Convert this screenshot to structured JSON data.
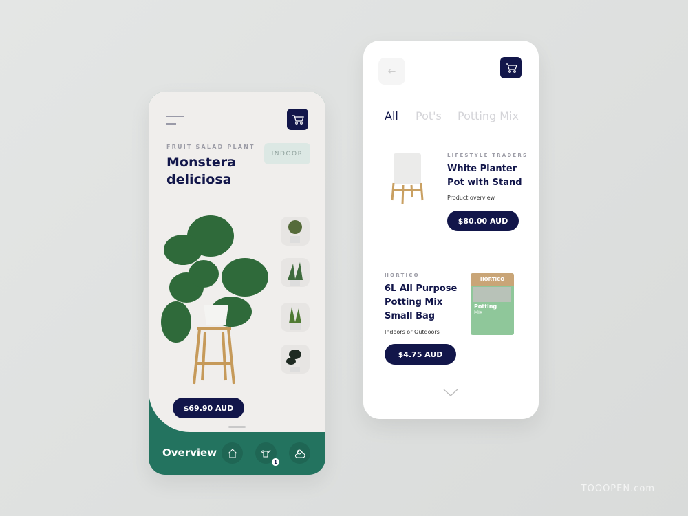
{
  "left": {
    "subtitle": "FRUIT SALAD PLANT",
    "title_line1": "Monstera",
    "title_line2": "deliciosa",
    "badge": "INDOOR",
    "price": "$69.90 AUD",
    "nav_label": "Overview",
    "nav_icons": [
      "home-icon",
      "watering-can-icon",
      "weather-icon"
    ],
    "notification_count": "1"
  },
  "right": {
    "tabs": [
      "All",
      "Pot's",
      "Potting Mix"
    ],
    "active_tab": "All",
    "products": [
      {
        "brand": "LIFESTYLE TRADERS",
        "name_line1": "White Planter",
        "name_line2": "Pot with Stand",
        "desc": "Product overview",
        "price": "$80.00 AUD"
      },
      {
        "brand": "HORTICO",
        "name_line1": "6L All Purpose",
        "name_line2": "Potting Mix",
        "name_line3": "Small Bag",
        "desc": "Indoors or Outdoors",
        "price": "$4.75 AUD",
        "package_text": [
          "HORTICO",
          "Potting",
          "Mix"
        ]
      }
    ]
  },
  "colors": {
    "navy": "#12164a",
    "green": "#23735f",
    "badge_bg": "#dce8e4"
  },
  "watermark": "TOOOPEN.com"
}
